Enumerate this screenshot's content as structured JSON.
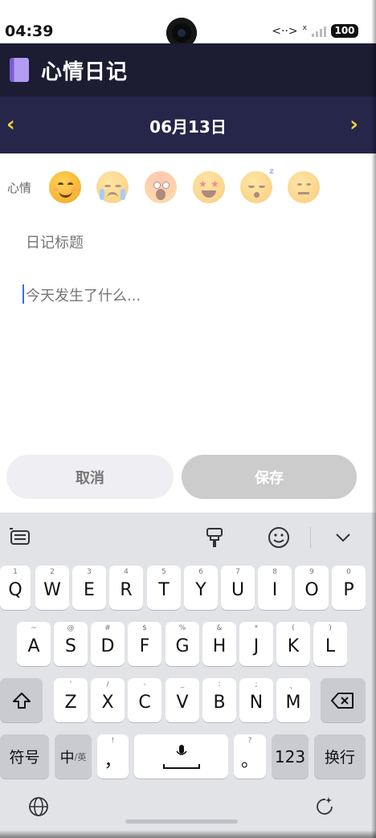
{
  "status_bar": {
    "time": "04:39",
    "network_icon_text": "<··>",
    "signal_prefix": "x",
    "battery": "100"
  },
  "header": {
    "title": "心情日记",
    "icon": "book-icon"
  },
  "date_nav": {
    "prev": "‹",
    "date": "06月13日",
    "next": "›"
  },
  "mood": {
    "label": "心情",
    "options": [
      {
        "name": "smile",
        "icon": "smiling-face-icon"
      },
      {
        "name": "sad",
        "icon": "crying-face-icon"
      },
      {
        "name": "scream",
        "icon": "screaming-face-icon"
      },
      {
        "name": "star-struck",
        "icon": "star-struck-face-icon"
      },
      {
        "name": "sleepy",
        "icon": "sleepy-face-icon"
      },
      {
        "name": "neutral",
        "icon": "neutral-face-icon"
      }
    ],
    "selected": "smile"
  },
  "form": {
    "title_placeholder": "日记标题",
    "content_placeholder": "今天发生了什么..."
  },
  "buttons": {
    "cancel": "取消",
    "save": "保存"
  },
  "keyboard": {
    "row1": [
      {
        "main": "Q",
        "sub": "1"
      },
      {
        "main": "W",
        "sub": "2"
      },
      {
        "main": "E",
        "sub": "3"
      },
      {
        "main": "R",
        "sub": "4"
      },
      {
        "main": "T",
        "sub": "5"
      },
      {
        "main": "Y",
        "sub": "6"
      },
      {
        "main": "U",
        "sub": "7"
      },
      {
        "main": "I",
        "sub": "8"
      },
      {
        "main": "O",
        "sub": "9"
      },
      {
        "main": "P",
        "sub": "0"
      }
    ],
    "row2": [
      {
        "main": "A",
        "sub": "~"
      },
      {
        "main": "S",
        "sub": "@"
      },
      {
        "main": "D",
        "sub": "#"
      },
      {
        "main": "F",
        "sub": "$"
      },
      {
        "main": "G",
        "sub": "%"
      },
      {
        "main": "H",
        "sub": "&"
      },
      {
        "main": "J",
        "sub": "*"
      },
      {
        "main": "K",
        "sub": "("
      },
      {
        "main": "L",
        "sub": ")"
      }
    ],
    "row3": [
      {
        "main": "Z",
        "sub": "'"
      },
      {
        "main": "X",
        "sub": "/"
      },
      {
        "main": "C",
        "sub": "-"
      },
      {
        "main": "V",
        "sub": "_"
      },
      {
        "main": "B",
        "sub": ":"
      },
      {
        "main": "N",
        "sub": ";"
      },
      {
        "main": "M",
        "sub": "、"
      }
    ],
    "symbols": "符号",
    "lang_main": "中",
    "lang_sub": "/英",
    "comma_main": "，",
    "comma_sub": "!",
    "period_main": "。",
    "period_sub": "?",
    "numbers": "123",
    "enter": "换行"
  }
}
